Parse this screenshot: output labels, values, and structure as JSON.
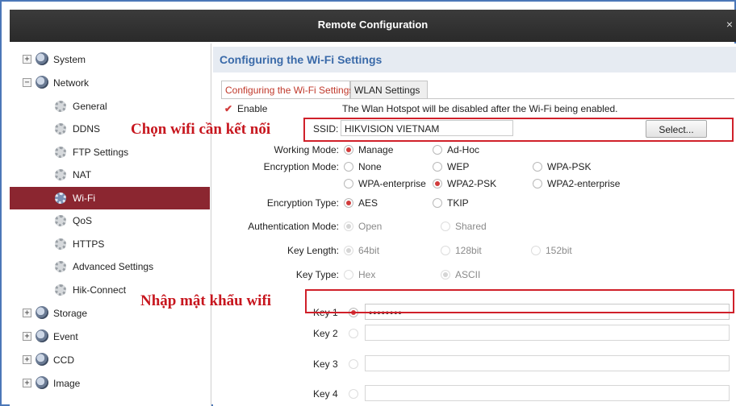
{
  "window": {
    "title": "Remote Configuration",
    "close_glyph": "×"
  },
  "sidebar": {
    "items": [
      {
        "label": "System",
        "kind": "category",
        "expander": "+",
        "icon": "category-icon"
      },
      {
        "label": "Network",
        "kind": "category",
        "expander": "−",
        "icon": "category-icon"
      },
      {
        "label": "General",
        "kind": "child",
        "icon": "gear-icon"
      },
      {
        "label": "DDNS",
        "kind": "child",
        "icon": "gear-icon"
      },
      {
        "label": "FTP Settings",
        "kind": "child",
        "icon": "gear-icon"
      },
      {
        "label": "NAT",
        "kind": "child",
        "icon": "gear-icon"
      },
      {
        "label": "Wi-Fi",
        "kind": "child",
        "icon": "gear-icon",
        "selected": true
      },
      {
        "label": "QoS",
        "kind": "child",
        "icon": "gear-icon"
      },
      {
        "label": "HTTPS",
        "kind": "child",
        "icon": "gear-icon"
      },
      {
        "label": "Advanced Settings",
        "kind": "child",
        "icon": "gear-icon"
      },
      {
        "label": "Hik-Connect",
        "kind": "child",
        "icon": "gear-icon"
      },
      {
        "label": "Storage",
        "kind": "category",
        "expander": "+",
        "icon": "category-icon"
      },
      {
        "label": "Event",
        "kind": "category",
        "expander": "+",
        "icon": "category-icon"
      },
      {
        "label": "CCD",
        "kind": "category",
        "expander": "+",
        "icon": "category-icon"
      },
      {
        "label": "Image",
        "kind": "category",
        "expander": "+",
        "icon": "category-icon"
      }
    ]
  },
  "main": {
    "title": "Configuring the Wi-Fi Settings",
    "tabs": [
      {
        "label": "Configuring the Wi-Fi Settings",
        "active": true
      },
      {
        "label": "WLAN Settings",
        "active": false
      }
    ],
    "enable": {
      "label": "Enable",
      "checked": true,
      "note": "The Wlan Hotspot will be disabled after the Wi-Fi being enabled."
    },
    "ssid": {
      "label": "SSID:",
      "value": "HIKVISION VIETNAM",
      "select_button": "Select..."
    },
    "working_mode": {
      "label": "Working Mode:",
      "options": [
        "Manage",
        "Ad-Hoc"
      ],
      "selected": "Manage"
    },
    "encryption_mode": {
      "label": "Encryption Mode:",
      "options": [
        "None",
        "WEP",
        "WPA-PSK",
        "WPA-enterprise",
        "WPA2-PSK",
        "WPA2-enterprise"
      ],
      "selected": "WPA2-PSK"
    },
    "encryption_type": {
      "label": "Encryption Type:",
      "options": [
        "AES",
        "TKIP"
      ],
      "selected": "AES"
    },
    "authentication_mode": {
      "label": "Authentication Mode:",
      "options": [
        "Open",
        "Shared"
      ],
      "selected": "Open"
    },
    "key_length": {
      "label": "Key Length:",
      "options": [
        "64bit",
        "128bit",
        "152bit"
      ],
      "selected": "64bit"
    },
    "key_type": {
      "label": "Key Type:",
      "options": [
        "Hex",
        "ASCII"
      ],
      "selected": "ASCII"
    },
    "keys": [
      {
        "label": "Key 1",
        "value": "••••••••",
        "selected": true
      },
      {
        "label": "Key 2",
        "value": "",
        "selected": false
      },
      {
        "label": "Key 3",
        "value": "",
        "selected": false
      },
      {
        "label": "Key 4",
        "value": "",
        "selected": false
      }
    ]
  },
  "annotations": {
    "ssid_note": "Chọn wifi cần kết nối",
    "key_note": "Nhập mật khẩu wifi",
    "highlight_color": "#d0202a"
  }
}
